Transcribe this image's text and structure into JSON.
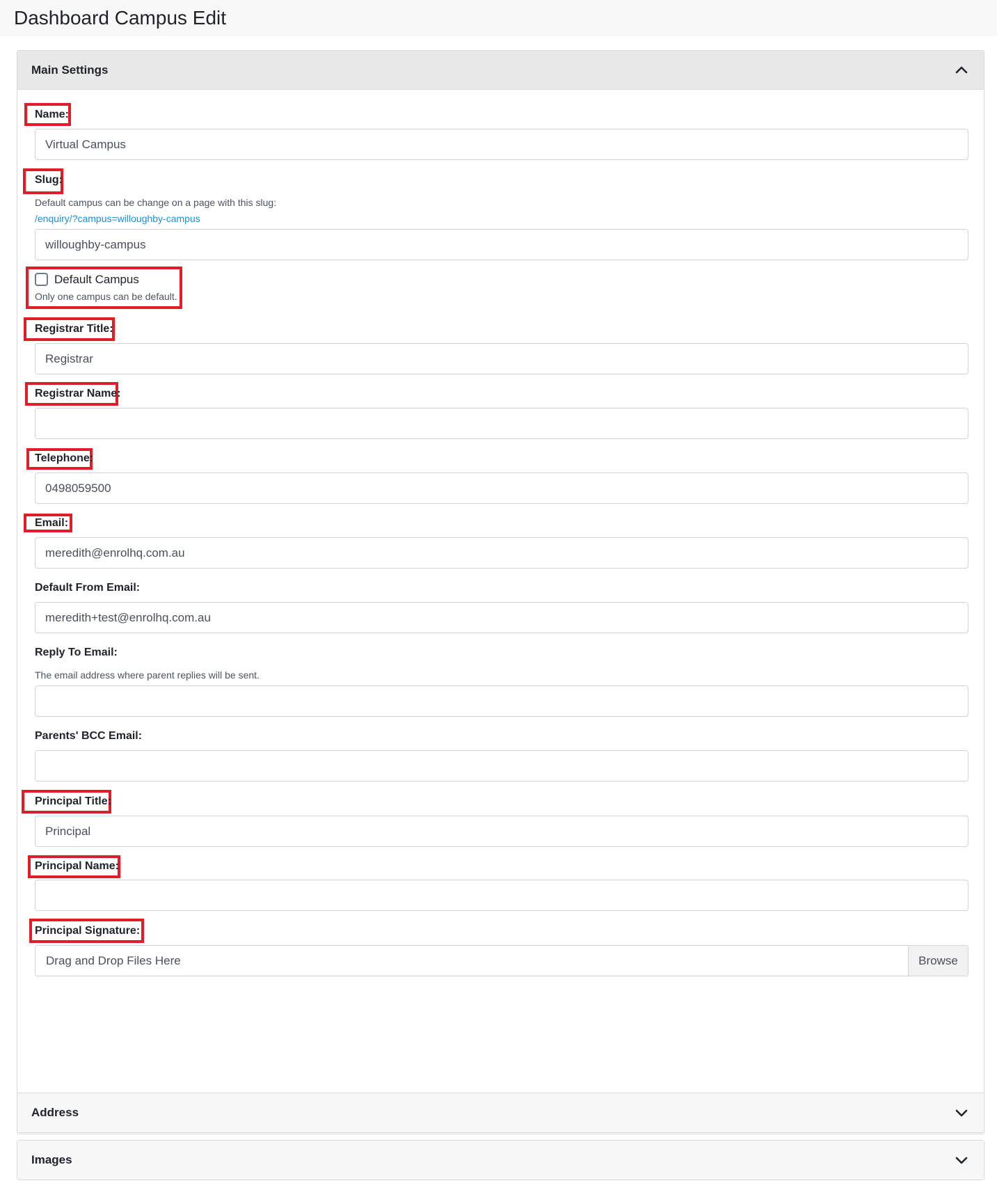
{
  "page": {
    "title": "Dashboard Campus Edit"
  },
  "main_settings": {
    "title": "Main Settings",
    "fields": {
      "name": {
        "label": "Name:",
        "value": "Virtual Campus"
      },
      "slug": {
        "label": "Slug:",
        "help": "Default campus can be change on a page with this slug:",
        "link": "/enquiry/?campus=willoughby-campus",
        "value": "willoughby-campus"
      },
      "default_campus": {
        "label": "Default Campus",
        "checked": false,
        "help": "Only one campus can be default."
      },
      "registrar_title": {
        "label": "Registrar Title:",
        "value": "Registrar"
      },
      "registrar_name": {
        "label": "Registrar Name:",
        "value": ""
      },
      "telephone": {
        "label": "Telephone:",
        "value": "0498059500"
      },
      "email": {
        "label": "Email:",
        "value": "meredith@enrolhq.com.au"
      },
      "default_from_email": {
        "label": "Default From Email:",
        "value": "meredith+test@enrolhq.com.au"
      },
      "reply_to_email": {
        "label": "Reply To Email:",
        "help": "The email address where parent replies will be sent.",
        "value": ""
      },
      "parents_bcc_email": {
        "label": "Parents' BCC Email:",
        "value": ""
      },
      "principal_title": {
        "label": "Principal Title:",
        "value": "Principal"
      },
      "principal_name": {
        "label": "Principal Name:",
        "value": ""
      },
      "principal_signature": {
        "label": "Principal Signature:",
        "placeholder": "Drag and Drop Files Here",
        "button": "Browse"
      }
    }
  },
  "address_panel": {
    "title": "Address"
  },
  "images_panel": {
    "title": "Images"
  },
  "colors": {
    "highlight": "#e11d2a",
    "link": "#1e8fd6",
    "header_active": "#e8e8e8"
  },
  "icons": {
    "expanded": "chevron-up-icon",
    "collapsed": "chevron-down-icon"
  }
}
